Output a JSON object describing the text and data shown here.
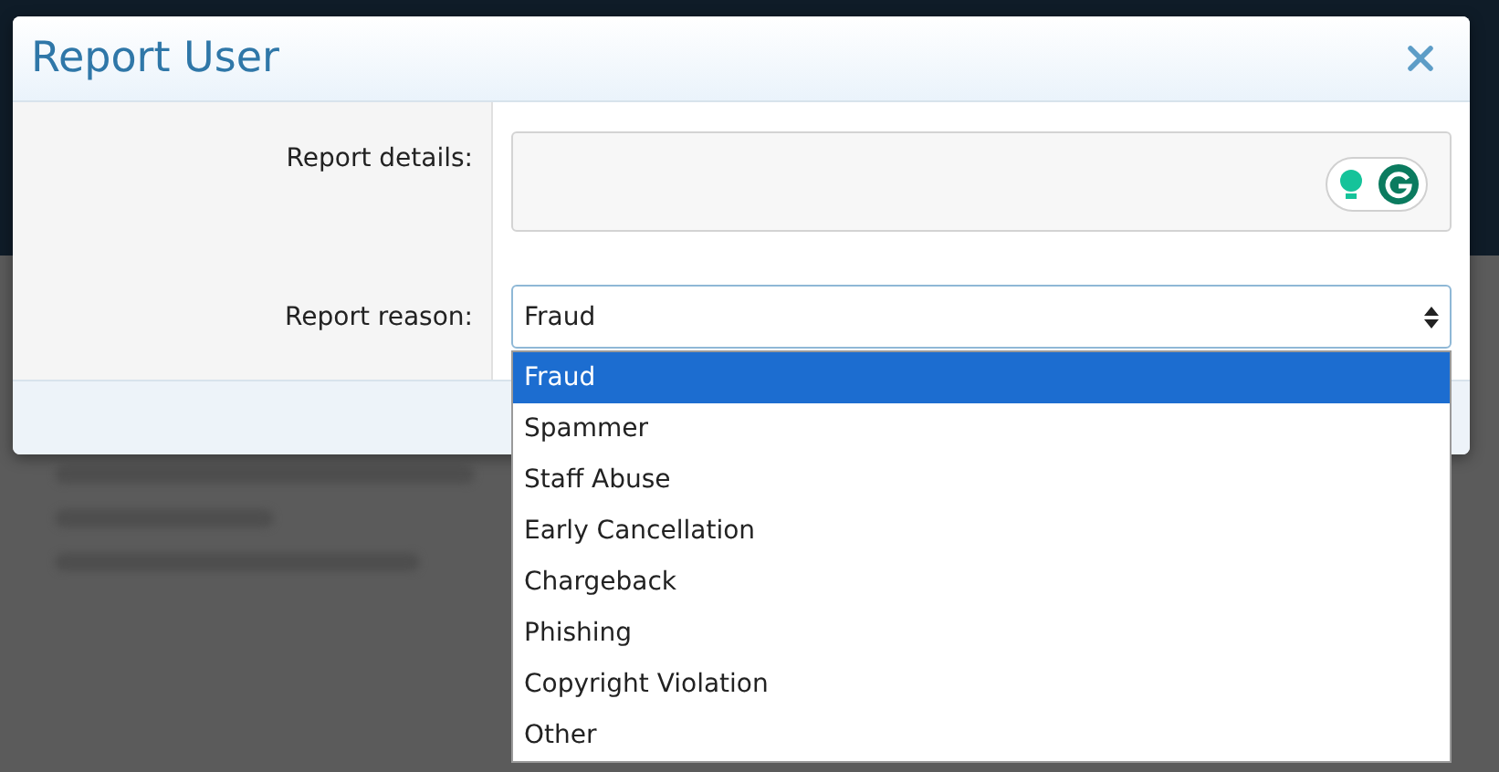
{
  "dialog": {
    "title": "Report User",
    "details": {
      "label": "Report details:"
    },
    "reason": {
      "label": "Report reason:",
      "value": "Fraud",
      "options": [
        {
          "label": "Fraud",
          "selected": true
        },
        {
          "label": "Spammer",
          "selected": false
        },
        {
          "label": "Staff Abuse",
          "selected": false
        },
        {
          "label": "Early Cancellation",
          "selected": false
        },
        {
          "label": "Chargeback",
          "selected": false
        },
        {
          "label": "Phishing",
          "selected": false
        },
        {
          "label": "Copyright Violation",
          "selected": false
        },
        {
          "label": "Other",
          "selected": false
        }
      ]
    }
  }
}
